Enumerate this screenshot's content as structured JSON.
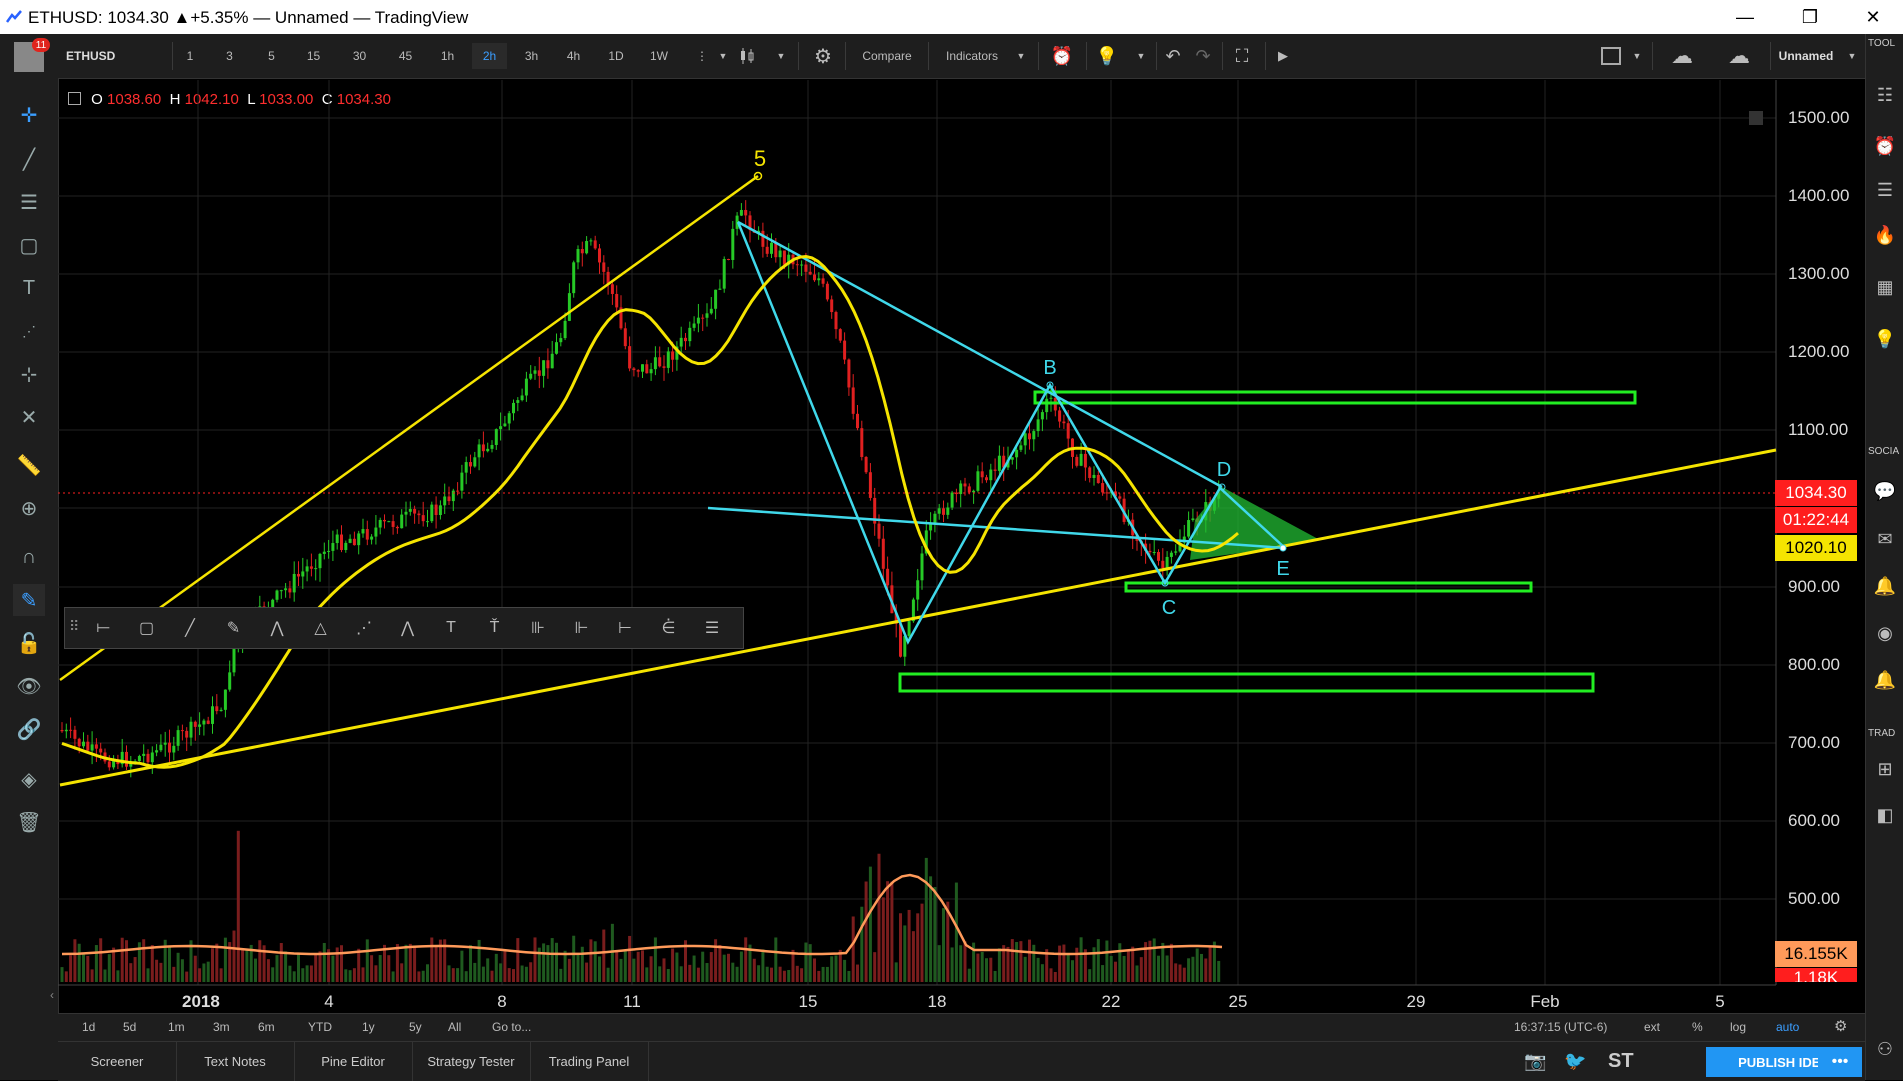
{
  "window": {
    "title": "ETHUSD: 1034.30 ▲+5.35% — Unnamed — TradingView"
  },
  "toolbar": {
    "symbol": "ETHUSD",
    "intervals": [
      "1",
      "3",
      "5",
      "15",
      "30",
      "45",
      "1h",
      "2h",
      "3h",
      "4h",
      "1D",
      "1W"
    ],
    "selected_interval": "2h",
    "compare_label": "Compare",
    "indicators_label": "Indicators",
    "layout_name": "Unnamed",
    "notification_count": "11"
  },
  "ohlc": {
    "o_label": "O",
    "o": "1038.60",
    "h_label": "H",
    "h": "1042.10",
    "l_label": "L",
    "l": "1033.00",
    "c_label": "C",
    "c": "1034.30"
  },
  "price_axis": {
    "labels": [
      "1500.00",
      "1400.00",
      "1300.00",
      "1200.00",
      "1100.00",
      "900.00",
      "800.00",
      "700.00",
      "600.00",
      "500.00"
    ],
    "last_price": "1034.30",
    "countdown": "01:22:44",
    "ma_value": "1020.10",
    "volume_value": "16.155K",
    "volume_ma_value": "1.18K"
  },
  "time_axis": {
    "labels": [
      "2018",
      "4",
      "8",
      "11",
      "15",
      "18",
      "22",
      "25",
      "29",
      "Feb",
      "5"
    ]
  },
  "annotations": {
    "wave5": "5",
    "B": "B",
    "C": "C",
    "D": "D",
    "E": "E"
  },
  "timeframes": [
    "1d",
    "5d",
    "1m",
    "3m",
    "6m",
    "YTD",
    "1y",
    "5y",
    "All",
    "Go to..."
  ],
  "clock": "16:37:15 (UTC-6)",
  "scale_options": [
    "ext",
    "%",
    "log",
    "auto"
  ],
  "bottom_tabs": [
    "Screener",
    "Text Notes",
    "Pine Editor",
    "Strategy Tester",
    "Trading Panel"
  ],
  "publish_label": "PUBLISH IDEA",
  "st_label": "ST",
  "right_panel_labels": [
    "TOOL",
    "SOCIA",
    "TRAD"
  ],
  "colors": {
    "bull": "#26c926",
    "bear": "#e02020",
    "ma": "#f5e400",
    "trend": "#f5e400",
    "pattern": "#40d8ea",
    "zone": "#22ee22",
    "last_price_badge": "#ff1e1e",
    "ma_badge": "#f5e400",
    "volume_ma": "#ff9a5a"
  }
}
